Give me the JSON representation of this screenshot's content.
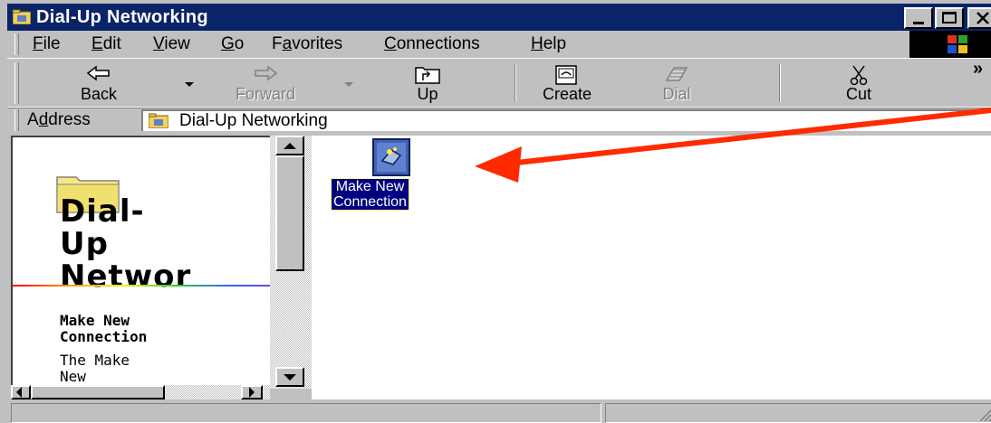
{
  "window": {
    "title": "Dial-Up Networking"
  },
  "menu": {
    "items": [
      {
        "label": "File",
        "mnemonic": "F",
        "rest": "ile"
      },
      {
        "label": "Edit",
        "mnemonic": "E",
        "rest": "dit"
      },
      {
        "label": "View",
        "mnemonic": "V",
        "rest": "iew"
      },
      {
        "label": "Go",
        "mnemonic": "G",
        "rest": "o"
      },
      {
        "label": "Favorites",
        "pre": "F",
        "mnemonic": "a",
        "rest": "vorites"
      },
      {
        "label": "Connections",
        "mnemonic": "C",
        "rest": "onnections"
      },
      {
        "label": "Help",
        "mnemonic": "H",
        "rest": "elp"
      }
    ]
  },
  "toolbar": {
    "back": "Back",
    "forward": "Forward",
    "up": "Up",
    "create": "Create",
    "dial": "Dial",
    "cut": "Cut",
    "more": "»"
  },
  "address": {
    "label_pre": "A",
    "label_mnemonic": "d",
    "label_rest": "dress",
    "value": "Dial-Up Networking"
  },
  "webview": {
    "title_line1": "Dial-",
    "title_line2": "Up",
    "title_line3": "Networ",
    "selected_name_line1": "Make New",
    "selected_name_line2": "Connection",
    "desc_line1": "The Make",
    "desc_line2": "New"
  },
  "files": [
    {
      "name_line1": "Make New",
      "name_line2": "Connection",
      "icon": "make-new-connection-icon"
    }
  ],
  "colors": {
    "titlebar": "#0a246a",
    "selection": "#000080",
    "arrow": "#ff2a00",
    "chrome": "#c0c0c0"
  }
}
